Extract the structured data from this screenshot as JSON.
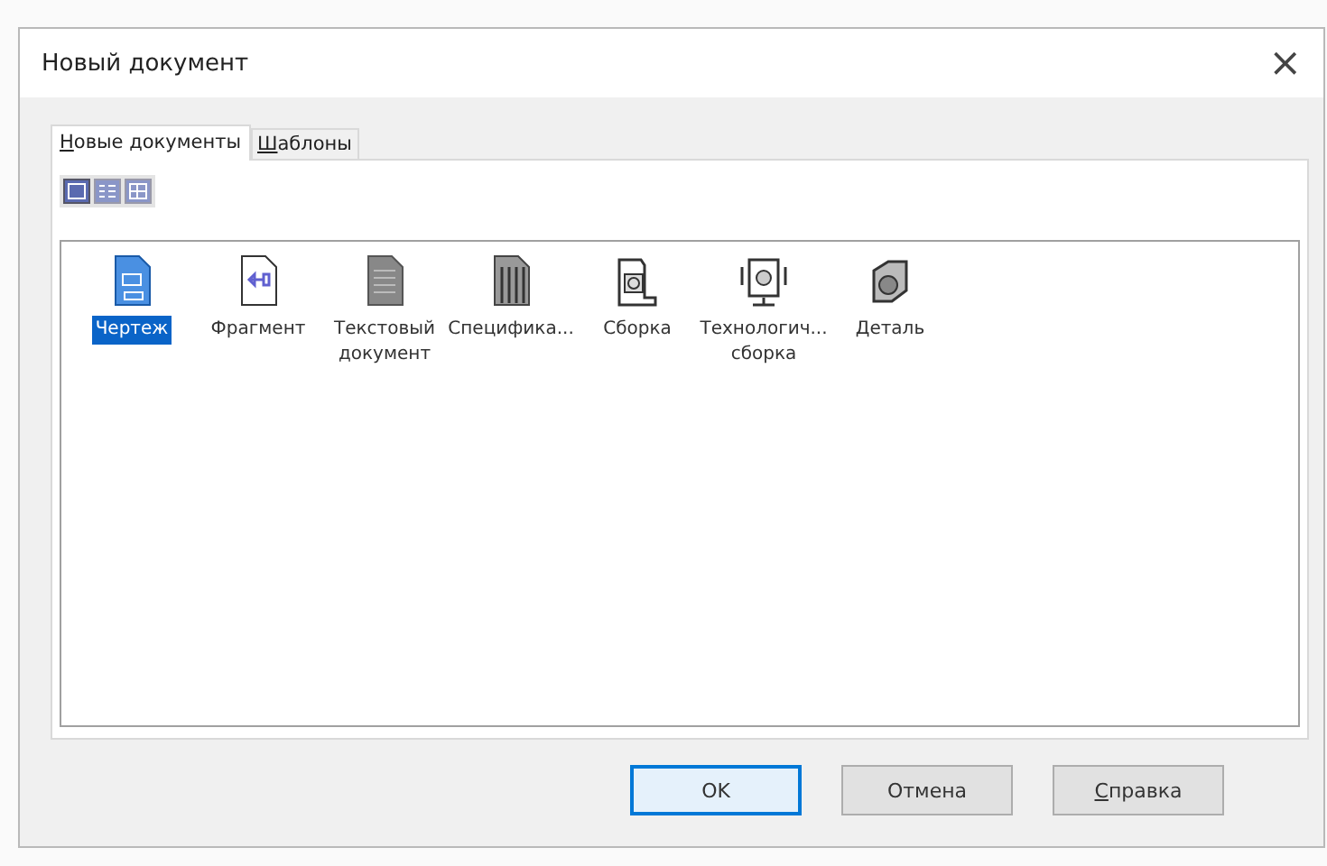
{
  "window": {
    "title": "Новый документ",
    "close": "×"
  },
  "tabs": [
    {
      "label": "Новые документы",
      "selected": true,
      "underline_first": true
    },
    {
      "label": "Шаблоны",
      "selected": false,
      "underline_first": true
    }
  ],
  "view_buttons": [
    {
      "kind": "large",
      "selected": true
    },
    {
      "kind": "list",
      "selected": false
    },
    {
      "kind": "details",
      "selected": false
    }
  ],
  "items": [
    {
      "kind": "drawing",
      "label": "Чертеж",
      "selected": true
    },
    {
      "kind": "fragment",
      "label": "Фрагмент",
      "selected": false
    },
    {
      "kind": "text",
      "label": "Текстовый документ",
      "selected": false
    },
    {
      "kind": "spec",
      "label": "Специфика...",
      "selected": false
    },
    {
      "kind": "assembly",
      "label": "Сборка",
      "selected": false
    },
    {
      "kind": "tech",
      "label": "Технологич... сборка",
      "selected": false
    },
    {
      "kind": "part",
      "label": "Деталь",
      "selected": false
    }
  ],
  "buttons": [
    {
      "label": "OK",
      "default": true,
      "underline_first": false
    },
    {
      "label": "Отмена",
      "default": false,
      "underline_first": false
    },
    {
      "label": "Справка",
      "default": false,
      "underline_first": true
    }
  ]
}
